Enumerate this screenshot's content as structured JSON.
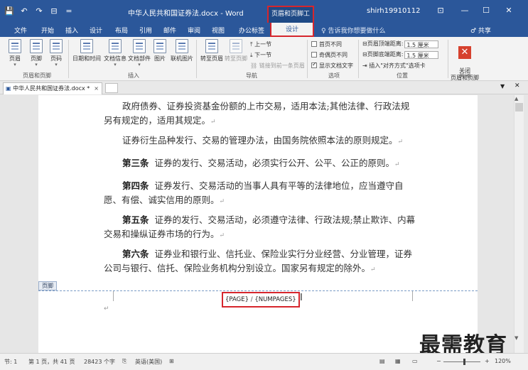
{
  "titlebar": {
    "qat": [
      "💾",
      "↶",
      "↷",
      "⊟",
      "="
    ],
    "doc_title": "中华人民共和国证券法.docx - Word",
    "context_tools": "页眉和页脚工具",
    "user": "shirh19910112",
    "win_buttons": [
      "⊡",
      "—",
      "☐",
      "✕"
    ]
  },
  "tabs": {
    "items": [
      "文件",
      "开始",
      "插入",
      "设计",
      "布局",
      "引用",
      "邮件",
      "审阅",
      "视图",
      "办公标签"
    ],
    "active": "设计",
    "tell_me": "♀ 告诉我你想要做什么",
    "share": "♂ 共享"
  },
  "ribbon": {
    "header_footer": {
      "buttons": [
        "页眉",
        "页脚",
        "页码"
      ],
      "label": "页眉和页脚"
    },
    "insert": {
      "buttons": [
        "日期和时间",
        "文档信息",
        "文档部件",
        "图片",
        "联机图片"
      ],
      "label": "插入"
    },
    "navigation": {
      "goto_header": "转至页眉",
      "goto_footer": "转至页脚",
      "prev": "上一节",
      "next": "下一节",
      "link_prev": "链接到前一条页眉",
      "label": "导航"
    },
    "options": {
      "first_page_diff": "首页不同",
      "odd_even_diff": "奇偶页不同",
      "show_doc_text": "显示文档文字",
      "show_doc_text_checked": true,
      "label": "选项"
    },
    "position": {
      "header_top": "页眉顶端距离:",
      "footer_bottom": "页脚底端距离:",
      "header_top_value": "1.5 厘米",
      "footer_bottom_value": "1.5 厘米",
      "insert_align_tab": "插入\"对齐方式\"选项卡",
      "label": "位置"
    },
    "close": {
      "button": "关闭\n页眉和页脚",
      "label": "关闭"
    }
  },
  "doctab": {
    "label": "中华人民共和国证券法.docx *",
    "close": "×"
  },
  "document": {
    "paragraphs": [
      {
        "lead": "",
        "text": "政府债券、证券投资基金份额的上市交易，适用本法;其他法律、行政法规另有规定的，适用其规定。"
      },
      {
        "lead": "",
        "text": "证券衍生品种发行、交易的管理办法，由国务院依照本法的原则规定。"
      },
      {
        "lead": "第三条",
        "text": "证券的发行、交易活动，必须实行公开、公平、公正的原则。"
      },
      {
        "lead": "第四条",
        "text": "证券发行、交易活动的当事人具有平等的法律地位，应当遵守自愿、有偿、诚实信用的原则。"
      },
      {
        "lead": "第五条",
        "text": "证券的发行、交易活动，必须遵守法律、行政法规;禁止欺诈、内幕交易和操纵证券市场的行为。"
      },
      {
        "lead": "第六条",
        "text": "证券业和银行业、信托业、保险业实行分业经营、分业管理，证券公司与银行、信托、保险业务机构分别设立。国家另有规定的除外。"
      }
    ],
    "para_mark": "↵",
    "footer_label": "页脚",
    "footer_field": {
      "page": "{PAGE}",
      "sep": "/",
      "numpages": "{NUMPAGES}"
    }
  },
  "watermark": "最需教育",
  "statusbar": {
    "section": "节: 1",
    "page": "第 1 页，共 41 页",
    "words": "28423 个字",
    "lang": "英语(美国)",
    "zoom": "120%",
    "zoom_minus": "−",
    "zoom_plus": "+"
  },
  "colors": {
    "accent": "#2b579a",
    "highlight": "#d6262d"
  }
}
